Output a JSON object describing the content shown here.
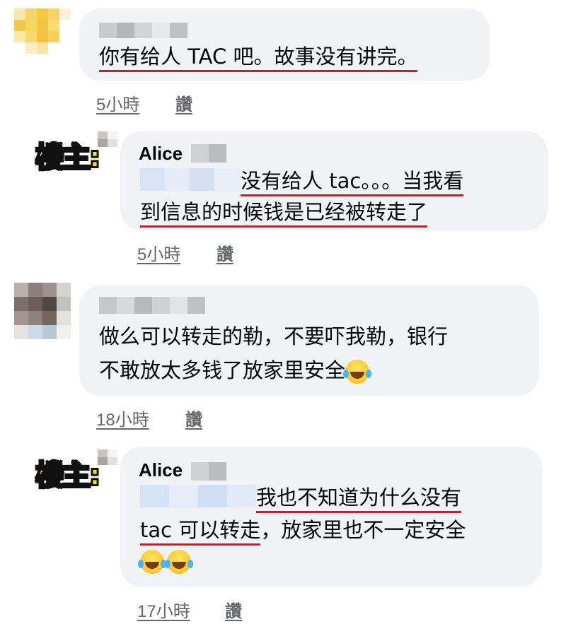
{
  "comments": [
    {
      "text": "你有给人 TAC 吧。故事没有讲完。",
      "time": "5小時",
      "like": "讚"
    },
    {
      "op_badge": "楼主:",
      "author": "Alice",
      "text_line1": "没有给人 tac。。。当我看",
      "text_line2": "到信息的时候钱是已经被转走了",
      "time": "5小時",
      "like": "讚"
    },
    {
      "text_line1": "做么可以转走的勒，不要吓我勒，银行",
      "text_line2": "不敢放太多钱了放家里安全",
      "emoji": "laughing-tears-emoji",
      "time": "18小時",
      "like": "讚"
    },
    {
      "op_badge": "楼主:",
      "author": "Alice",
      "text_line1_underlined": "我也不知道为什么没有",
      "text_line2_underlined": "tac 可以转走",
      "text_line2_rest": "，放家里也不一定安全",
      "emoji": "laughing-tears-emoji",
      "time": "17小時",
      "like": "讚"
    }
  ],
  "colors": {
    "bubble": "#f0f2f5",
    "underline": "#e8101d",
    "meta": "#65676b",
    "badge": "#ffe600"
  }
}
